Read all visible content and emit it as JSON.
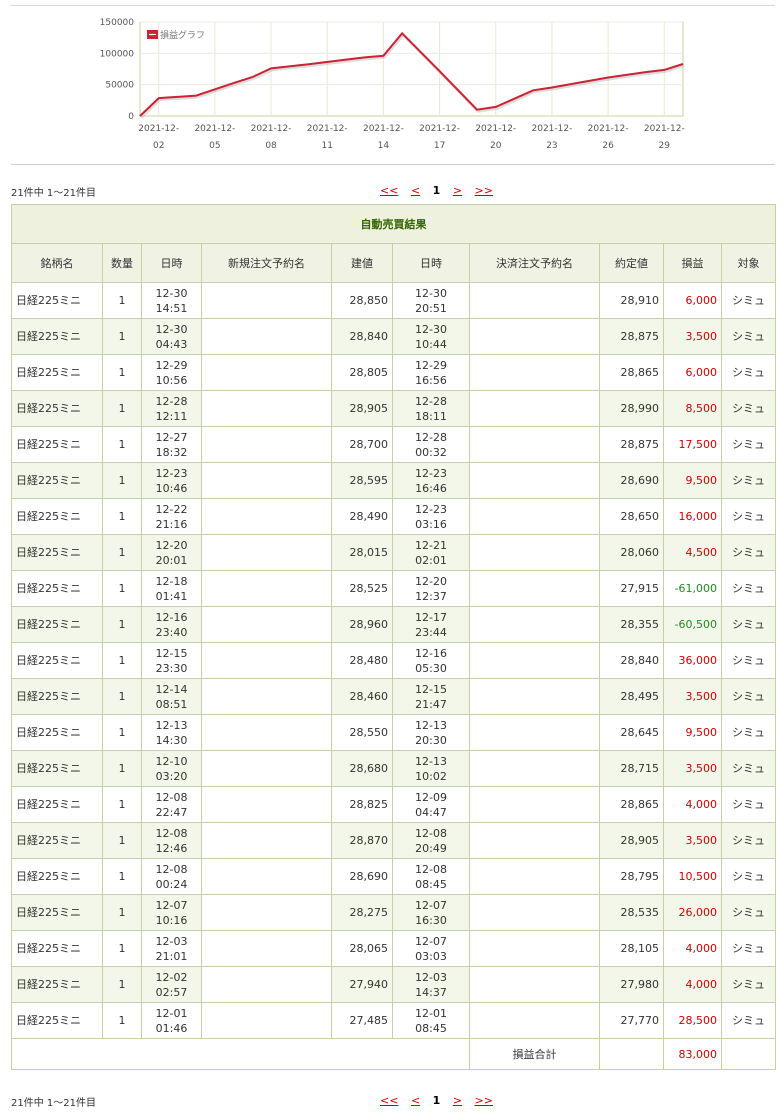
{
  "chart_data": {
    "type": "line",
    "legend": "損益グラフ",
    "legend_position": "top-left",
    "series_color": "#cc2233",
    "ylim": [
      0,
      150000
    ],
    "yticks": [
      "150000",
      "100000",
      "50000",
      "0"
    ],
    "x_tick_labels": [
      {
        "top": "2021-12-",
        "bottom": "02"
      },
      {
        "top": "2021-12-",
        "bottom": "05"
      },
      {
        "top": "2021-12-",
        "bottom": "08"
      },
      {
        "top": "2021-12-",
        "bottom": "11"
      },
      {
        "top": "2021-12-",
        "bottom": "14"
      },
      {
        "top": "2021-12-",
        "bottom": "17"
      },
      {
        "top": "2021-12-",
        "bottom": "20"
      },
      {
        "top": "2021-12-",
        "bottom": "23"
      },
      {
        "top": "2021-12-",
        "bottom": "26"
      },
      {
        "top": "2021-12-",
        "bottom": "29"
      }
    ],
    "x": [
      "2021-12-01",
      "2021-12-02",
      "2021-12-04",
      "2021-12-06",
      "2021-12-07",
      "2021-12-08",
      "2021-12-10",
      "2021-12-12",
      "2021-12-13",
      "2021-12-14",
      "2021-12-15",
      "2021-12-17",
      "2021-12-19",
      "2021-12-20",
      "2021-12-22",
      "2021-12-23",
      "2021-12-26",
      "2021-12-28",
      "2021-12-29",
      "2021-12-30"
    ],
    "values": [
      0,
      28500,
      32500,
      52500,
      62000,
      76000,
      82500,
      90000,
      93500,
      96000,
      132000,
      71500,
      10000,
      14500,
      41000,
      45500,
      61500,
      70000,
      73500,
      83000
    ]
  },
  "pager": {
    "count": "21件中 1〜21件目",
    "first": "<<",
    "prev": "<",
    "current": "1",
    "next": ">",
    "last": ">>"
  },
  "table": {
    "title": "自動売買結果",
    "headers": [
      "銘柄名",
      "数量",
      "日時",
      "新規注文予約名",
      "建値",
      "日時",
      "決済注文予約名",
      "約定値",
      "損益",
      "対象"
    ],
    "rows": [
      {
        "name": "日経225ミニ",
        "qty": "1",
        "od": "12-30",
        "ot": "14:51",
        "open": "28,850",
        "cd": "12-30",
        "ct": "20:51",
        "close": "28,910",
        "pl": "6,000",
        "target": "シミュ"
      },
      {
        "name": "日経225ミニ",
        "qty": "1",
        "od": "12-30",
        "ot": "04:43",
        "open": "28,840",
        "cd": "12-30",
        "ct": "10:44",
        "close": "28,875",
        "pl": "3,500",
        "target": "シミュ"
      },
      {
        "name": "日経225ミニ",
        "qty": "1",
        "od": "12-29",
        "ot": "10:56",
        "open": "28,805",
        "cd": "12-29",
        "ct": "16:56",
        "close": "28,865",
        "pl": "6,000",
        "target": "シミュ"
      },
      {
        "name": "日経225ミニ",
        "qty": "1",
        "od": "12-28",
        "ot": "12:11",
        "open": "28,905",
        "cd": "12-28",
        "ct": "18:11",
        "close": "28,990",
        "pl": "8,500",
        "target": "シミュ"
      },
      {
        "name": "日経225ミニ",
        "qty": "1",
        "od": "12-27",
        "ot": "18:32",
        "open": "28,700",
        "cd": "12-28",
        "ct": "00:32",
        "close": "28,875",
        "pl": "17,500",
        "target": "シミュ"
      },
      {
        "name": "日経225ミニ",
        "qty": "1",
        "od": "12-23",
        "ot": "10:46",
        "open": "28,595",
        "cd": "12-23",
        "ct": "16:46",
        "close": "28,690",
        "pl": "9,500",
        "target": "シミュ"
      },
      {
        "name": "日経225ミニ",
        "qty": "1",
        "od": "12-22",
        "ot": "21:16",
        "open": "28,490",
        "cd": "12-23",
        "ct": "03:16",
        "close": "28,650",
        "pl": "16,000",
        "target": "シミュ"
      },
      {
        "name": "日経225ミニ",
        "qty": "1",
        "od": "12-20",
        "ot": "20:01",
        "open": "28,015",
        "cd": "12-21",
        "ct": "02:01",
        "close": "28,060",
        "pl": "4,500",
        "target": "シミュ"
      },
      {
        "name": "日経225ミニ",
        "qty": "1",
        "od": "12-18",
        "ot": "01:41",
        "open": "28,525",
        "cd": "12-20",
        "ct": "12:37",
        "close": "27,915",
        "pl": "-61,000",
        "target": "シミュ"
      },
      {
        "name": "日経225ミニ",
        "qty": "1",
        "od": "12-16",
        "ot": "23:40",
        "open": "28,960",
        "cd": "12-17",
        "ct": "23:44",
        "close": "28,355",
        "pl": "-60,500",
        "target": "シミュ"
      },
      {
        "name": "日経225ミニ",
        "qty": "1",
        "od": "12-15",
        "ot": "23:30",
        "open": "28,480",
        "cd": "12-16",
        "ct": "05:30",
        "close": "28,840",
        "pl": "36,000",
        "target": "シミュ"
      },
      {
        "name": "日経225ミニ",
        "qty": "1",
        "od": "12-14",
        "ot": "08:51",
        "open": "28,460",
        "cd": "12-15",
        "ct": "21:47",
        "close": "28,495",
        "pl": "3,500",
        "target": "シミュ"
      },
      {
        "name": "日経225ミニ",
        "qty": "1",
        "od": "12-13",
        "ot": "14:30",
        "open": "28,550",
        "cd": "12-13",
        "ct": "20:30",
        "close": "28,645",
        "pl": "9,500",
        "target": "シミュ"
      },
      {
        "name": "日経225ミニ",
        "qty": "1",
        "od": "12-10",
        "ot": "03:20",
        "open": "28,680",
        "cd": "12-13",
        "ct": "10:02",
        "close": "28,715",
        "pl": "3,500",
        "target": "シミュ"
      },
      {
        "name": "日経225ミニ",
        "qty": "1",
        "od": "12-08",
        "ot": "22:47",
        "open": "28,825",
        "cd": "12-09",
        "ct": "04:47",
        "close": "28,865",
        "pl": "4,000",
        "target": "シミュ"
      },
      {
        "name": "日経225ミニ",
        "qty": "1",
        "od": "12-08",
        "ot": "12:46",
        "open": "28,870",
        "cd": "12-08",
        "ct": "20:49",
        "close": "28,905",
        "pl": "3,500",
        "target": "シミュ"
      },
      {
        "name": "日経225ミニ",
        "qty": "1",
        "od": "12-08",
        "ot": "00:24",
        "open": "28,690",
        "cd": "12-08",
        "ct": "08:45",
        "close": "28,795",
        "pl": "10,500",
        "target": "シミュ"
      },
      {
        "name": "日経225ミニ",
        "qty": "1",
        "od": "12-07",
        "ot": "10:16",
        "open": "28,275",
        "cd": "12-07",
        "ct": "16:30",
        "close": "28,535",
        "pl": "26,000",
        "target": "シミュ"
      },
      {
        "name": "日経225ミニ",
        "qty": "1",
        "od": "12-03",
        "ot": "21:01",
        "open": "28,065",
        "cd": "12-07",
        "ct": "03:03",
        "close": "28,105",
        "pl": "4,000",
        "target": "シミュ"
      },
      {
        "name": "日経225ミニ",
        "qty": "1",
        "od": "12-02",
        "ot": "02:57",
        "open": "27,940",
        "cd": "12-03",
        "ct": "14:37",
        "close": "27,980",
        "pl": "4,000",
        "target": "シミュ"
      },
      {
        "name": "日経225ミニ",
        "qty": "1",
        "od": "12-01",
        "ot": "01:46",
        "open": "27,485",
        "cd": "12-01",
        "ct": "08:45",
        "close": "27,770",
        "pl": "28,500",
        "target": "シミュ"
      }
    ],
    "total_label": "損益合計",
    "total_value": "83,000"
  }
}
